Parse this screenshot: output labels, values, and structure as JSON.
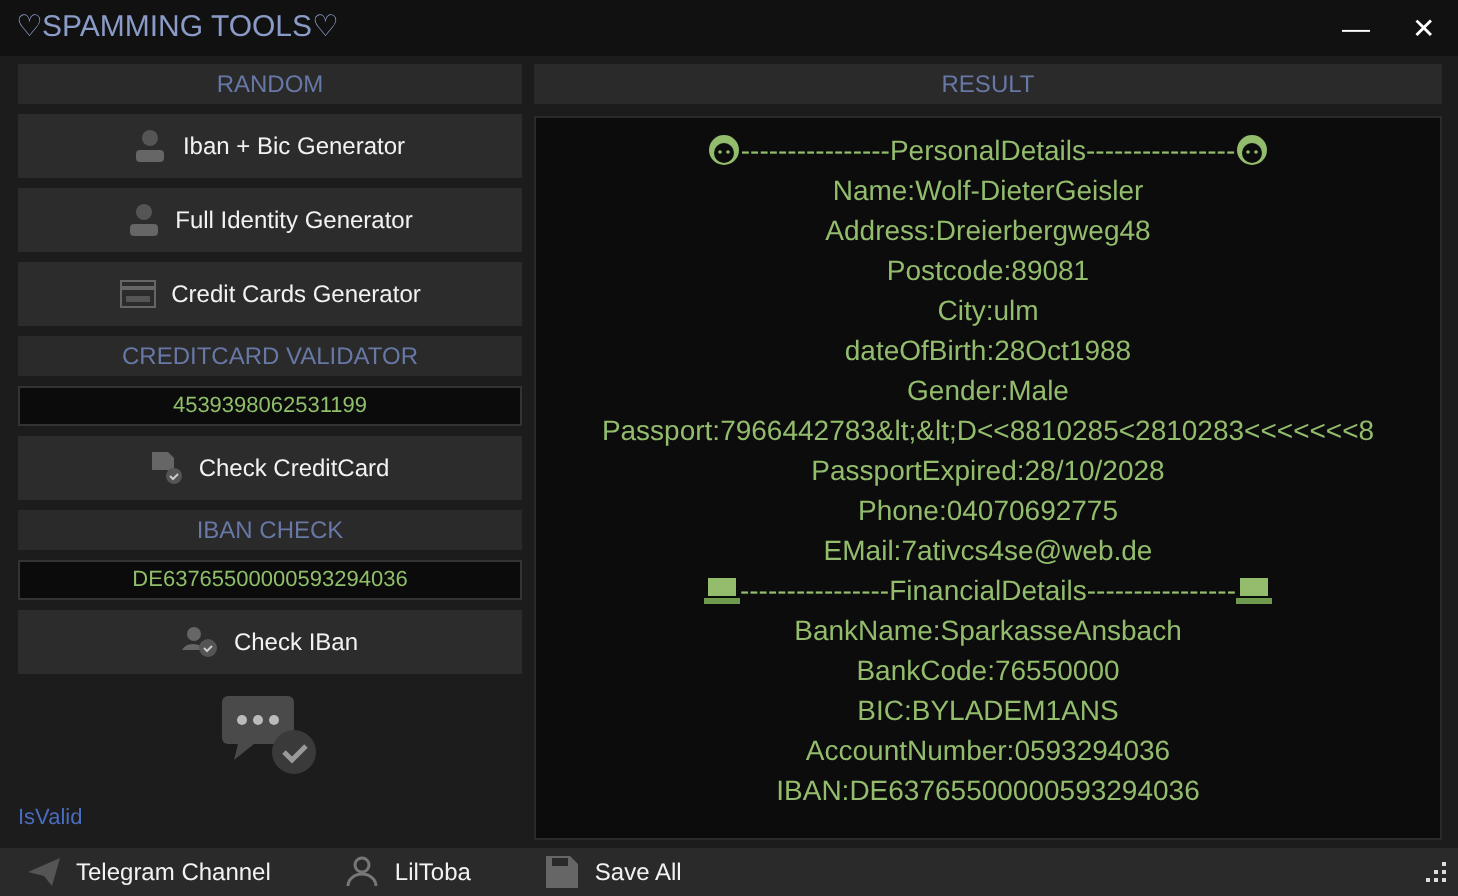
{
  "window": {
    "title": "♡SPAMMING TOOLS♡",
    "controls": [
      "—",
      "✕"
    ]
  },
  "random": {
    "heading": "RANDOM",
    "buttons": [
      {
        "label": "Iban + Bic Generator"
      },
      {
        "label": "Full Identity Generator"
      },
      {
        "label": "Credit Cards Generator"
      }
    ]
  },
  "validator": {
    "heading": "CREDITCARD VALIDATOR",
    "value": "4539398062531199",
    "button": "Check CreditCard"
  },
  "iban_check": {
    "heading": "IBAN CHECK",
    "value": "DE63765500000593294036",
    "button": "Check IBan"
  },
  "status_text": "IsValid",
  "result": {
    "heading": "RESULT",
    "lines": [
      {
        "kind": "heading",
        "text": "----------------PersonalDetails----------------"
      },
      {
        "kind": "line",
        "text": "Name:Wolf-DieterGeisler"
      },
      {
        "kind": "line",
        "text": "Address:Dreierbergweg48"
      },
      {
        "kind": "line",
        "text": "Postcode:89081"
      },
      {
        "kind": "line",
        "text": "City:ulm"
      },
      {
        "kind": "line",
        "text": "dateOfBirth:28Oct1988"
      },
      {
        "kind": "line",
        "text": "Gender:Male"
      },
      {
        "kind": "line",
        "text": "Passport:7966442783&lt;&lt;D<<8810285<2810283<<<<<<<8"
      },
      {
        "kind": "line",
        "text": "PassportExpired:28/10/2028"
      },
      {
        "kind": "line",
        "text": "Phone:04070692775"
      },
      {
        "kind": "line",
        "text": "EMail:7ativcs4se@web.de"
      },
      {
        "kind": "heading",
        "text": "----------------FinancialDetails----------------"
      },
      {
        "kind": "line",
        "text": "BankName:SparkasseAnsbach"
      },
      {
        "kind": "line",
        "text": "BankCode:76550000"
      },
      {
        "kind": "line",
        "text": "BIC:BYLADEM1ANS"
      },
      {
        "kind": "line",
        "text": "AccountNumber:0593294036"
      },
      {
        "kind": "line",
        "text": "IBAN:DE63765500000593294036"
      }
    ]
  },
  "status_bar": [
    {
      "label": "Telegram Channel"
    },
    {
      "label": "LilToba"
    },
    {
      "label": "Save All"
    }
  ]
}
